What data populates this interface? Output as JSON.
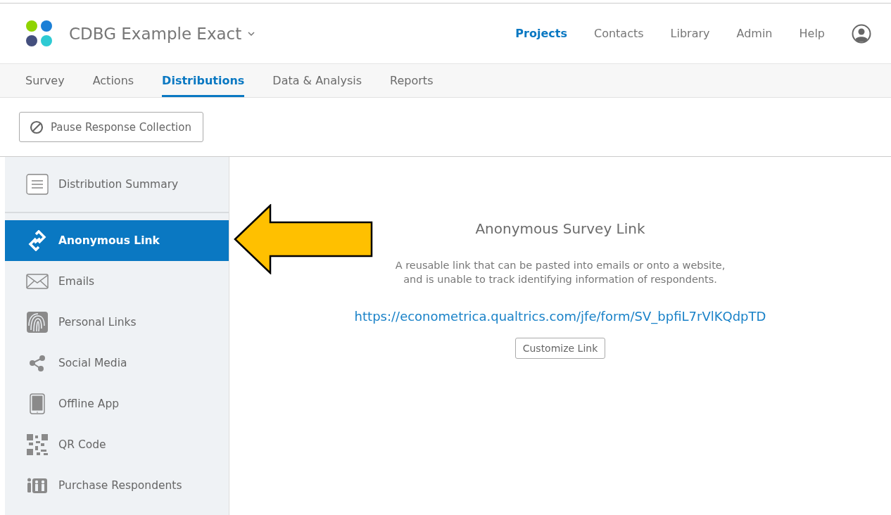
{
  "header": {
    "project_title": "CDBG Example Exact",
    "nav": [
      {
        "label": "Projects",
        "selected": true
      },
      {
        "label": "Contacts",
        "selected": false
      },
      {
        "label": "Library",
        "selected": false
      },
      {
        "label": "Admin",
        "selected": false
      },
      {
        "label": "Help",
        "selected": false
      }
    ]
  },
  "tabs": [
    {
      "label": "Survey",
      "selected": false
    },
    {
      "label": "Actions",
      "selected": false
    },
    {
      "label": "Distributions",
      "selected": true
    },
    {
      "label": "Data & Analysis",
      "selected": false
    },
    {
      "label": "Reports",
      "selected": false
    }
  ],
  "pause_button": "Pause Response Collection",
  "sidebar": {
    "summary": {
      "label": "Distribution Summary",
      "selected": false
    },
    "items": [
      {
        "label": "Anonymous Link",
        "selected": true
      },
      {
        "label": "Emails",
        "selected": false
      },
      {
        "label": "Personal Links",
        "selected": false
      },
      {
        "label": "Social Media",
        "selected": false
      },
      {
        "label": "Offline App",
        "selected": false
      },
      {
        "label": "QR Code",
        "selected": false
      },
      {
        "label": "Purchase Respondents",
        "selected": false
      }
    ]
  },
  "main": {
    "title": "Anonymous Survey Link",
    "description": [
      "A reusable link that can be pasted into emails or onto a website,",
      "and is unable to track identifying information of respondents."
    ],
    "link": "https://econometrica.qualtrics.com/jfe/form/SV_bpfiL7rVlKQdpTD",
    "customize_button": "Customize Link"
  }
}
